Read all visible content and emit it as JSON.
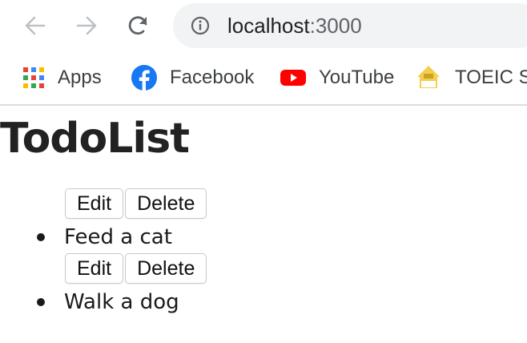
{
  "browser": {
    "url_host": "localhost",
    "url_port": ":3000",
    "bookmarks": [
      {
        "label": "Apps",
        "icon": "apps-grid-icon"
      },
      {
        "label": "Facebook",
        "icon": "facebook-icon"
      },
      {
        "label": "YouTube",
        "icon": "youtube-icon"
      },
      {
        "label": "TOEIC Sc",
        "icon": "toeic-icon"
      }
    ]
  },
  "app": {
    "title": "TodoList",
    "todos": [
      {
        "text": "Feed a cat",
        "edit_label": "Edit",
        "delete_label": "Delete"
      },
      {
        "text": "Walk a dog",
        "edit_label": "Edit",
        "delete_label": "Delete"
      }
    ]
  },
  "colors": {
    "facebook": "#1877f2",
    "youtube": "#ff0000",
    "omnibox_bg": "#f1f3f4"
  }
}
